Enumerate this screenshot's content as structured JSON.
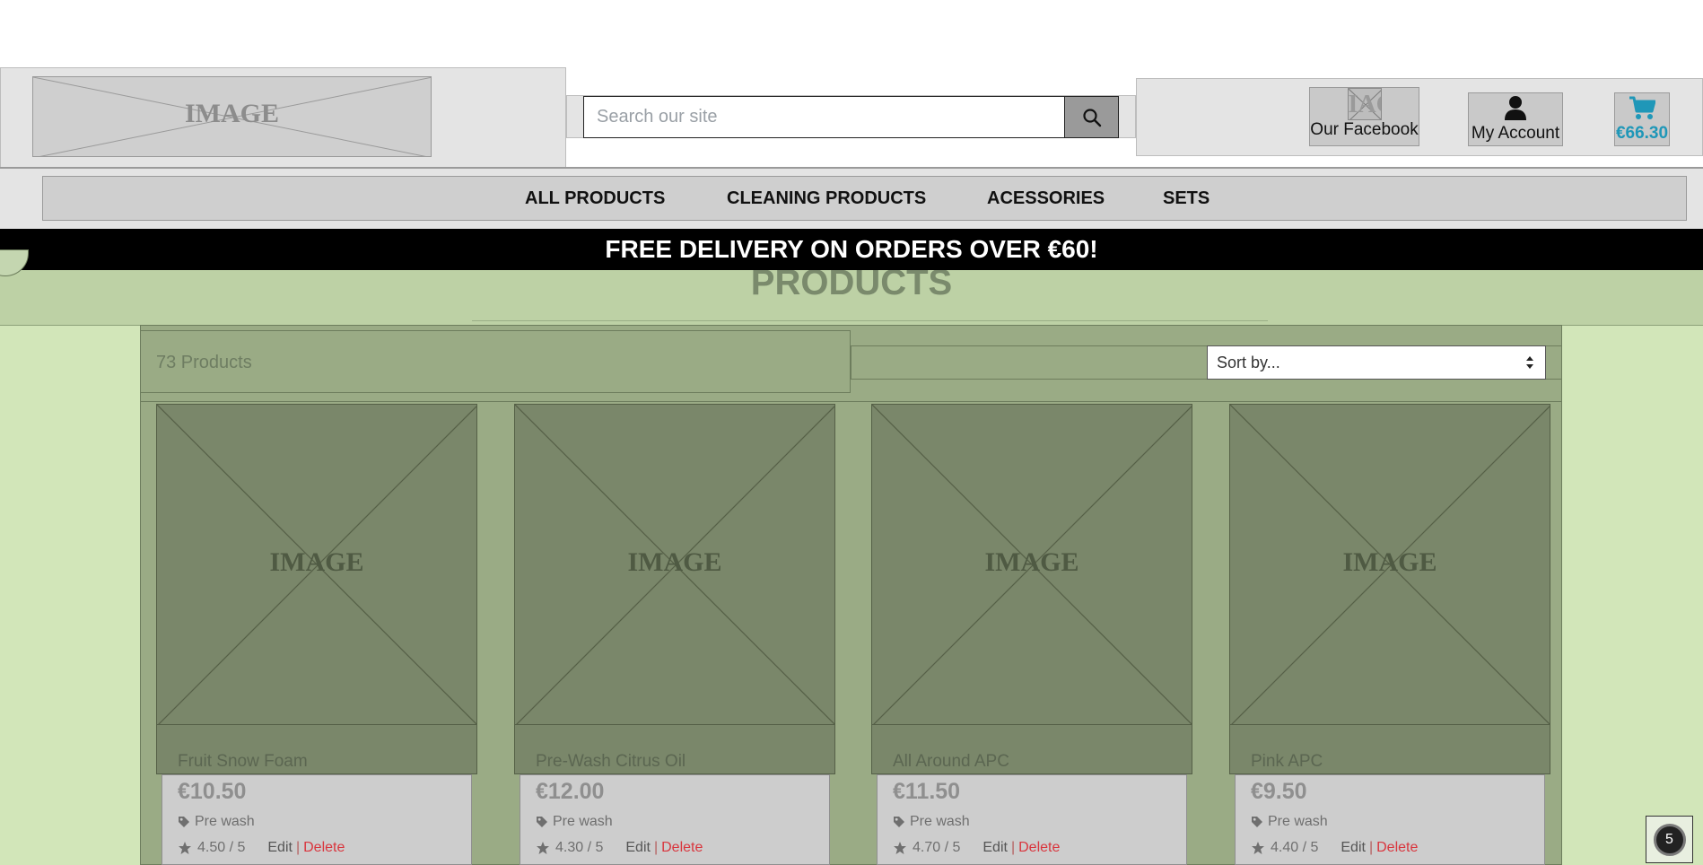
{
  "header": {
    "logo_text": "IMAGE",
    "search_placeholder": "Search our site",
    "facebook": {
      "icon_text": "IAG",
      "label": "Our Facebook"
    },
    "account_label": "My Account",
    "cart_total": "€66.30"
  },
  "menu": {
    "items": [
      {
        "label": "ALL PRODUCTS"
      },
      {
        "label": "CLEANING PRODUCTS"
      },
      {
        "label": "ACESSORIES"
      },
      {
        "label": "SETS"
      }
    ]
  },
  "banner": {
    "text": "FREE DELIVERY ON ORDERS OVER €60!"
  },
  "page": {
    "title": "PRODUCTS"
  },
  "toolbar": {
    "count_text": "73 Products",
    "sort_value": "Sort by..."
  },
  "products": [
    {
      "image_text": "IMAGE",
      "name": "Fruit Snow Foam",
      "price": "€10.50",
      "category": "Pre wash",
      "rating": "4.50 / 5",
      "edit": "Edit",
      "sep": "|",
      "delete": "Delete"
    },
    {
      "image_text": "IMAGE",
      "name": "Pre-Wash Citrus Oil",
      "price": "€12.00",
      "category": "Pre wash",
      "rating": "4.30 / 5",
      "edit": "Edit",
      "sep": "|",
      "delete": "Delete"
    },
    {
      "image_text": "IMAGE",
      "name": "All Around APC",
      "price": "€11.50",
      "category": "Pre wash",
      "rating": "4.70 / 5",
      "edit": "Edit",
      "sep": "|",
      "delete": "Delete"
    },
    {
      "image_text": "IMAGE",
      "name": "Pink APC",
      "price": "€9.50",
      "category": "Pre wash",
      "rating": "4.40 / 5",
      "edit": "Edit",
      "sep": "|",
      "delete": "Delete"
    }
  ],
  "floating": {
    "badge": "5"
  },
  "colors": {
    "page_bg": "#d2e6b9",
    "banner_bg": "#000000",
    "cart_accent": "#1f97b8",
    "delete_red": "#d9363e"
  },
  "icons": [
    "search-icon",
    "user-icon",
    "cart-icon",
    "tag-icon",
    "star-icon"
  ]
}
